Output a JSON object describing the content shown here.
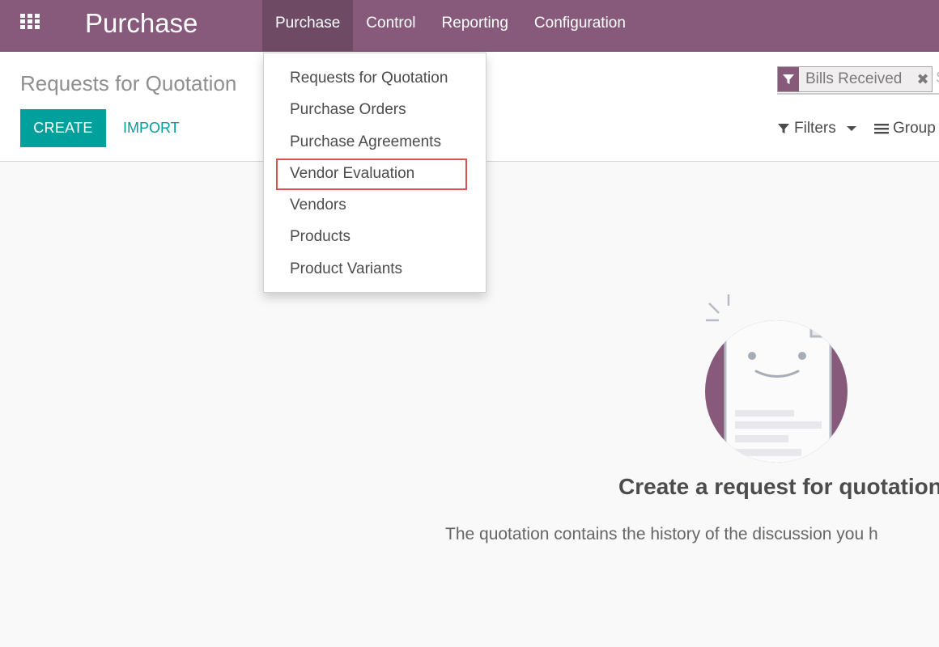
{
  "navbar": {
    "brand": "Purchase",
    "menu": [
      {
        "label": "Purchase"
      },
      {
        "label": "Control"
      },
      {
        "label": "Reporting"
      },
      {
        "label": "Configuration"
      }
    ],
    "color": "#875a7b"
  },
  "control_panel": {
    "breadcrumb": "Requests for Quotation",
    "create_label": "CREATE",
    "import_label": "IMPORT",
    "facet_label": "Bills Received",
    "search_fragment": "S",
    "filters_label": "Filters",
    "group_label": "Group"
  },
  "dropdown": {
    "items": [
      {
        "label": "Requests for Quotation"
      },
      {
        "label": "Purchase Orders"
      },
      {
        "label": "Purchase Agreements"
      },
      {
        "label": "Vendor Evaluation"
      },
      {
        "label": "Vendors"
      },
      {
        "label": "Products"
      },
      {
        "label": "Product Variants"
      }
    ],
    "highlighted_item": "Vendor Evaluation"
  },
  "empty_state": {
    "title": "Create a request for quotation",
    "description": "The quotation contains the history of the discussion you h"
  },
  "colors": {
    "brand": "#875a7b",
    "primary_button": "#00a09d",
    "highlight_border": "#d9534f"
  }
}
